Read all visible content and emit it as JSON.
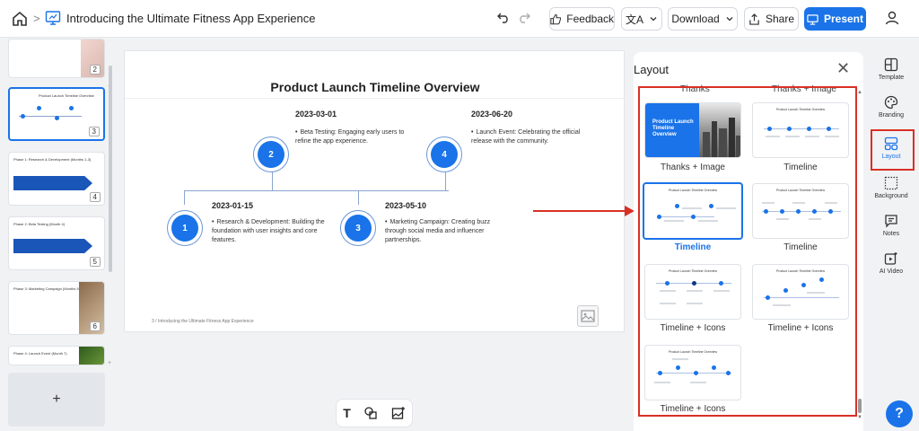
{
  "header": {
    "doc_title": "Introducing the Ultimate Fitness App Experience",
    "breadcrumb_sep": ">",
    "feedback": "Feedback",
    "download": "Download",
    "share": "Share",
    "present": "Present"
  },
  "thumbnails": [
    {
      "num": "2",
      "title": ""
    },
    {
      "num": "3",
      "title": "Product Launch Timeline Overview"
    },
    {
      "num": "4",
      "title": "Phase 1: Research & Development (Months 1-3)"
    },
    {
      "num": "5",
      "title": "Phase 2: Beta Testing (Month 4)"
    },
    {
      "num": "6",
      "title": "Phase 3: Marketing Campaign (Months 5-6)"
    },
    {
      "num": "",
      "title": "Phase 4: Launch Event (Month 7)"
    }
  ],
  "add_slide": "+",
  "slide": {
    "title": "Product Launch Timeline Overview",
    "footer": "3  /  Introducing the Ultimate Fitness App Experience",
    "items": [
      {
        "num": "1",
        "date": "2023-01-15",
        "text": "Research & Development: Building the foundation with user insights and core features."
      },
      {
        "num": "2",
        "date": "2023-03-01",
        "text": "Beta Testing: Engaging early users to refine the app experience."
      },
      {
        "num": "3",
        "date": "2023-05-10",
        "text": "Marketing Campaign: Creating buzz through social media and influencer partnerships."
      },
      {
        "num": "4",
        "date": "2023-06-20",
        "text": "Launch Event: Celebrating the official release with the community."
      }
    ]
  },
  "layout_panel": {
    "title": "Layout",
    "close": "✕",
    "cut_left": "Thanks",
    "cut_right": "Thanks + Image",
    "thanks_card_title": "Product Launch Timeline Overview",
    "cards": [
      {
        "label": "Thanks + Image"
      },
      {
        "label": "Timeline"
      },
      {
        "label": "Timeline"
      },
      {
        "label": "Timeline"
      },
      {
        "label": "Timeline + Icons"
      },
      {
        "label": "Timeline + Icons"
      },
      {
        "label": "Timeline + Icons"
      }
    ],
    "selected_index": 2
  },
  "rail": [
    {
      "label": "Template",
      "icon": "template-icon"
    },
    {
      "label": "Branding",
      "icon": "palette-icon"
    },
    {
      "label": "Layout",
      "icon": "layout-icon"
    },
    {
      "label": "Background",
      "icon": "background-icon"
    },
    {
      "label": "Notes",
      "icon": "notes-icon"
    },
    {
      "label": "AI Video",
      "icon": "ai-video-icon"
    }
  ],
  "help": "?",
  "colors": {
    "accent": "#1a73e8",
    "annotation": "#d93025"
  }
}
